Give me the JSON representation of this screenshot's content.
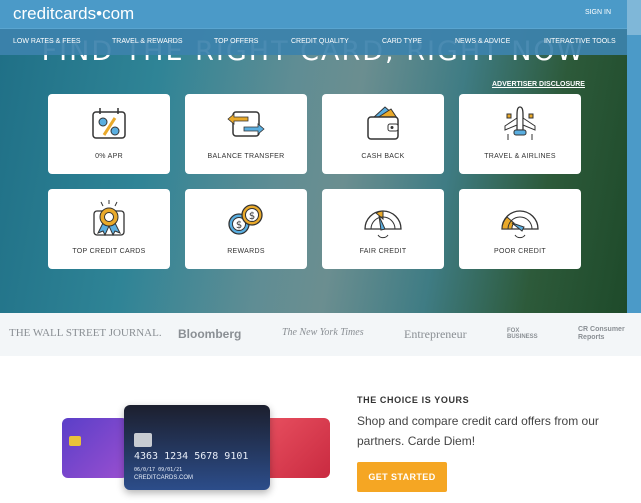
{
  "header": {
    "logo": "creditcards•com",
    "sign_in": "SIGN IN"
  },
  "nav": [
    "LOW RATES & FEES",
    "TRAVEL & REWARDS",
    "TOP OFFERS",
    "CREDIT QUALITY",
    "CARD TYPE",
    "NEWS & ADVICE",
    "INTERACTIVE TOOLS"
  ],
  "hero": {
    "title": "FIND THE RIGHT CARD, RIGHT NOW",
    "disclosure": "ADVERTISER DISCLOSURE"
  },
  "tiles": [
    {
      "label": "0% APR",
      "icon": "calendar-percent-icon"
    },
    {
      "label": "BALANCE TRANSFER",
      "icon": "transfer-arrows-icon"
    },
    {
      "label": "CASH BACK",
      "icon": "wallet-icon"
    },
    {
      "label": "TRAVEL & AIRLINES",
      "icon": "airplane-icon"
    },
    {
      "label": "TOP CREDIT CARDS",
      "icon": "award-ribbon-icon"
    },
    {
      "label": "REWARDS",
      "icon": "coins-icon"
    },
    {
      "label": "FAIR CREDIT",
      "icon": "gauge-fair-icon"
    },
    {
      "label": "POOR CREDIT",
      "icon": "gauge-poor-icon"
    }
  ],
  "press": [
    "THE WALL STREET JOURNAL.",
    "Bloomberg",
    "The New York Times",
    "Entrepreneur",
    "FOX BUSINESS",
    "CR Consumer Reports"
  ],
  "promo": {
    "heading": "THE CHOICE IS YOURS",
    "text": "Shop and compare credit card offers from our partners. Carde Diem!",
    "button": "GET STARTED",
    "card_number": "4363  1234  5678  9101",
    "card_dates": "06/0/17    09/01/21",
    "card_brand": "CREDITCARDS.COM"
  },
  "colors": {
    "header": "#4b9ac8",
    "button": "#f5a623",
    "icon_blue": "#5aaee0",
    "icon_gold": "#e9a92a"
  }
}
